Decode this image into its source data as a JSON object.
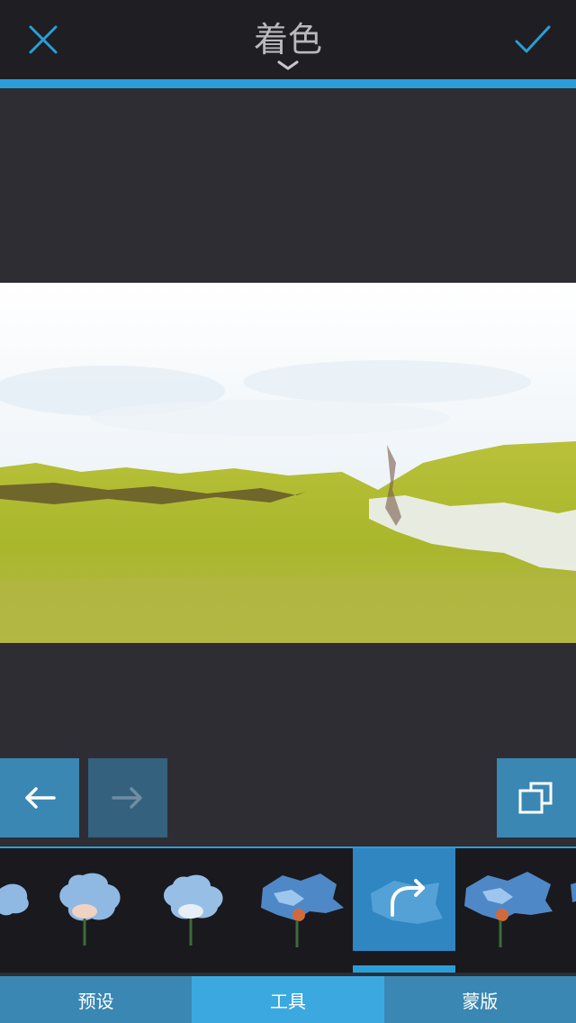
{
  "header": {
    "title": "着色"
  },
  "tabs": [
    {
      "label": "预设",
      "active": false
    },
    {
      "label": "工具",
      "active": true
    },
    {
      "label": "蒙版",
      "active": false
    }
  ],
  "tool_strip": {
    "selected_index": 4,
    "items": [
      "brush-1",
      "brush-2",
      "brush-3",
      "brush-4",
      "brush-5",
      "brush-6",
      "brush-7"
    ]
  },
  "colors": {
    "accent": "#2a9ed8",
    "topbar": "#1f1e22",
    "background": "#2e2d33"
  }
}
